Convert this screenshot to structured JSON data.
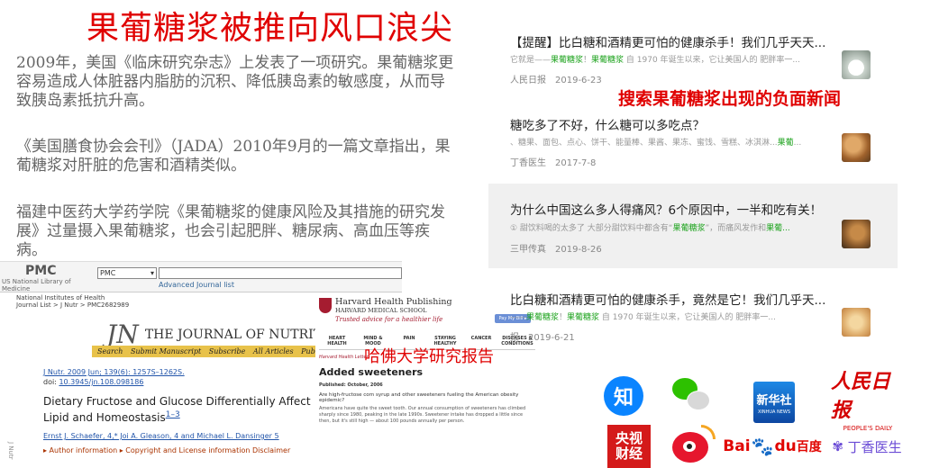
{
  "main": {
    "title": "果葡糖浆被推向风口浪尖",
    "paragraphs": [
      "2009年，美国《临床研究杂志》上发表了一项研究。果葡糖浆更容易造成人体脏器内脂肪的沉积、降低胰岛素的敏感度，从而导致胰岛素抵抗升高。",
      "《美国膳食协会会刊》（JADA）2010年9月的一篇文章指出，果葡糖浆对肝脏的危害和酒精类似。",
      "福建中医药大学药学院《果葡糖浆的健康风险及其措施的研究发展》过量摄入果葡糖浆，也会引起肥胖、糖尿病、高血压等疾病。"
    ]
  },
  "pmc": {
    "logo": "PMC",
    "logo_sub": "US National Library of Medicine",
    "select_value": "PMC",
    "advanced": "Advanced",
    "journal_list": "Journal list",
    "nih": "National Institutes of Health",
    "breadcrumb": "Journal List > J Nutr > PMC2682989",
    "journal_logo": "JN",
    "journal_name": "THE JOURNAL OF NUTRITION",
    "nav": [
      "Search",
      "Submit Manuscript",
      "Subscribe",
      "All Articles",
      "Published W"
    ],
    "citation": "J Nutr. 2009 Jun; 139(6): 1257S–1262S.",
    "doi_label": "doi:",
    "doi": "10.3945/jn.108.098186",
    "article_title": "Dietary Fructose and Glucose Differentially Affect Lipid and Homeostasis",
    "article_sup": "1–3",
    "authors": "Ernst J. Schaefer, 4,* Joi A. Gleason, 4 and Michael L. Dansinger 5",
    "author_info": "▸ Author information ▸ Copyright and License information Disclaimer",
    "side_label": "J Nutr"
  },
  "harvard": {
    "publishing": "Harvard Health Publishing",
    "school": "HARVARD MEDICAL SCHOOL",
    "tagline": "Trusted advice for a healthier life",
    "nav": [
      "HEART HEALTH",
      "MIND & MOOD",
      "PAIN",
      "STAYING HEALTHY",
      "CANCER",
      "DISEASES & CONDITIONS"
    ],
    "letter": "Harvard Health Letter",
    "title": "Added sweeteners",
    "published": "Published: October, 2006",
    "question": "Are high-fructose corn syrup and other sweeteners fueling the American obesity epidemic?",
    "body": "Americans have quite the sweet tooth. Our annual consumption of sweeteners has climbed sharply since 1980, peaking in the late 1990s. Sweetener intake has dropped a little since then, but it's still high — about 100 pounds annually per person.",
    "pay_button": "Pay My Bill ▸",
    "caption": "哈佛大学研究报告"
  },
  "news_caption": "搜索果葡糖浆出现的负面新闻",
  "news": [
    {
      "title": "【提醒】比白糖和酒精更可怕的健康杀手！我们几乎天天...",
      "snippet_pre": "它就是——",
      "snippet_hl1": "果葡糖浆",
      "snippet_mid": "！",
      "snippet_hl2": "果葡糖浆",
      "snippet_post": " 自 1970 年诞生以来，它让美国人的 肥胖率一...",
      "source": "人民日报",
      "date": "2019-6-23",
      "thumb": "milk-glass-thumbnail"
    },
    {
      "title": "糖吃多了不好，什么糖可以多吃点？",
      "snippet_pre": "、糖果、面包、点心、饼干、能量棒、果酱、果冻、蜜饯、雪糕、冰淇淋...",
      "snippet_hl1": "果葡",
      "snippet_mid": "",
      "snippet_hl2": "",
      "snippet_post": "...",
      "source": "丁香医生",
      "date": "2017-7-8",
      "thumb": "sweets-thumbnail"
    },
    {
      "title": "为什么中国这么多人得痛风？6个原因中，一半和吃有关！",
      "snippet_pre": "① 甜饮料喝的太多了 大部分甜饮料中都含有“",
      "snippet_hl1": "果葡糖浆",
      "snippet_mid": "”，而痛风发作和",
      "snippet_hl2": "果葡...",
      "snippet_post": "",
      "source": "三甲传真",
      "date": "2019-8-26",
      "thumb": "food-thumbnail"
    },
    {
      "title": "比白糖和酒精更可怕的健康杀手，竟然是它！我们几乎天...",
      "snippet_pre": "——",
      "snippet_hl1": "果葡糖浆",
      "snippet_mid": "！",
      "snippet_hl2": "果葡糖浆",
      "snippet_post": " 自 1970 年诞生以来，它让美国人的 肥胖率一...",
      "source": "报",
      "date": "2019-6-21",
      "thumb": "drink-thumbnail"
    }
  ],
  "logos": {
    "zhihu": "知",
    "xinhua": "新华社",
    "xinhua_sub": "XINHUA NEWS",
    "peoples": "人民日报",
    "peoples_sub": "PEOPLE'S DAILY",
    "cctv_1": "央视",
    "cctv_2": "财经",
    "baidu_bai": "Bai",
    "baidu_paw": "du",
    "baidu_cn": "百度",
    "dingxiang": "丁香医生"
  },
  "colors": {
    "headline_red": "#e00000",
    "highlight_green": "#1ea31e",
    "link_blue": "#2255aa"
  }
}
